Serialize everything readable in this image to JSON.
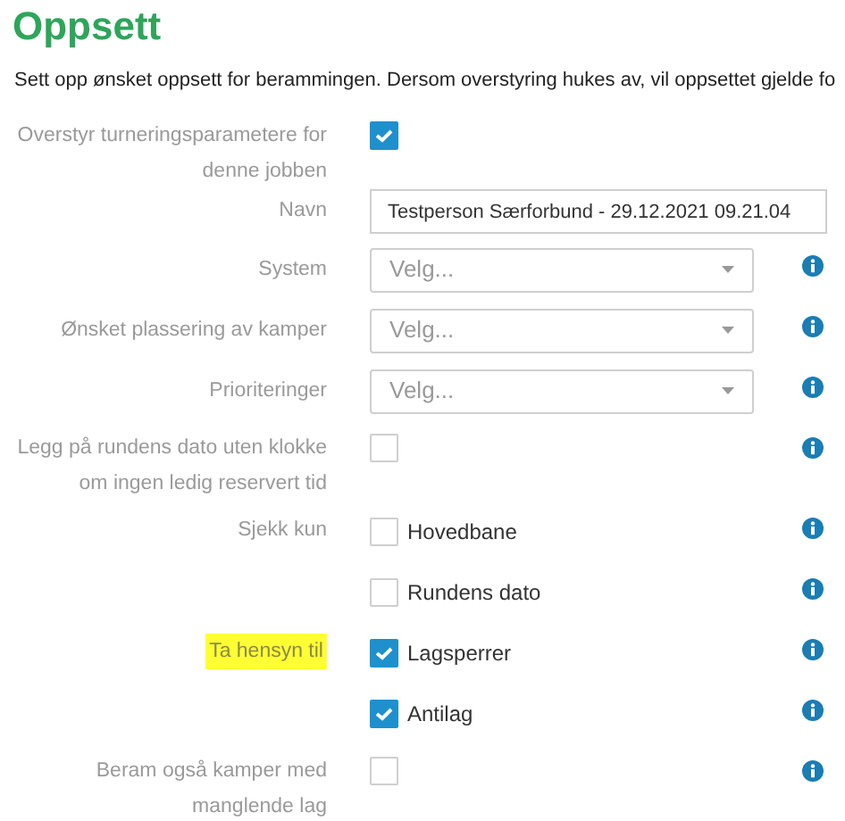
{
  "title": "Oppsett",
  "description": "Sett opp ønsket oppsett for berammingen. Dersom overstyring hukes av, vil oppsettet gjelde fo",
  "rows": [
    {
      "kind": "checkbox",
      "label": "Overstyr turneringsparametere for denne jobben",
      "highlighted": false,
      "info": false,
      "checked": true
    },
    {
      "kind": "text",
      "label": "Navn",
      "highlighted": false,
      "info": false,
      "value": "Testperson Særforbund - 29.12.2021 09.21.04"
    },
    {
      "kind": "select",
      "label": "System",
      "highlighted": false,
      "info": true,
      "placeholder": "Velg..."
    },
    {
      "kind": "select",
      "label": "Ønsket plassering av kamper",
      "highlighted": false,
      "info": true,
      "placeholder": "Velg..."
    },
    {
      "kind": "select",
      "label": "Prioriteringer",
      "highlighted": false,
      "info": true,
      "placeholder": "Velg..."
    },
    {
      "kind": "checkbox",
      "label": "Legg på rundens dato uten klokke om ingen ledig reservert tid",
      "highlighted": false,
      "info": true,
      "checked": false
    },
    {
      "kind": "options",
      "label": "Sjekk kun",
      "highlighted": false,
      "options": [
        {
          "label": "Hovedbane",
          "checked": false,
          "info": true
        },
        {
          "label": "Rundens dato",
          "checked": false,
          "info": true
        }
      ]
    },
    {
      "kind": "options",
      "label": "Ta hensyn til",
      "highlighted": true,
      "options": [
        {
          "label": "Lagsperrer",
          "checked": true,
          "info": true
        },
        {
          "label": "Antilag",
          "checked": true,
          "info": true
        }
      ]
    },
    {
      "kind": "checkbox",
      "label": "Beram også kamper med manglende lag",
      "highlighted": false,
      "info": true,
      "checked": false
    }
  ]
}
